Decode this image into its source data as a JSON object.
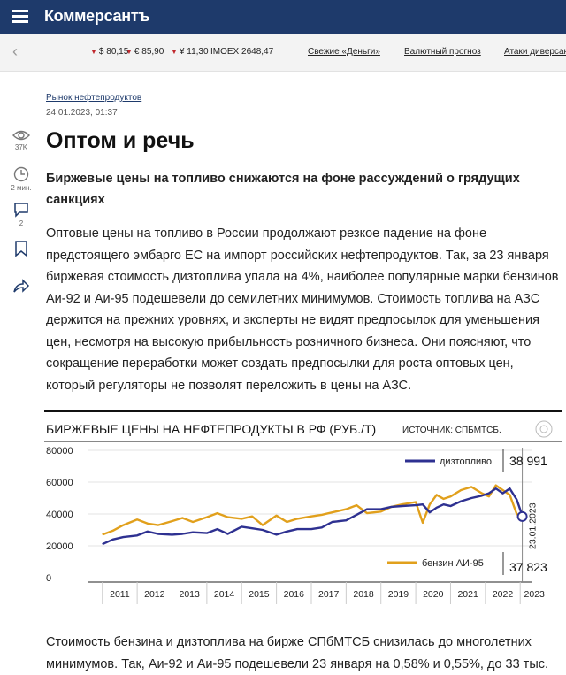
{
  "header": {
    "logo": "Коммерсантъ"
  },
  "ticker": {
    "usd": "$ 80,15",
    "eur": "€ 85,90",
    "cny": "¥ 11,30",
    "imoex": "IMOEX 2648,47",
    "links": [
      "Свежие «Деньги»",
      "Валютный прогноз",
      "Атаки диверсан"
    ]
  },
  "sidebar": {
    "views": "37K",
    "read_time": "2 мин.",
    "comments": "2"
  },
  "article": {
    "rubric": "Рынок нефтепродуктов",
    "date": "24.01.2023, 01:37",
    "title": "Оптом и речь",
    "subtitle": "Биржевые цены на топливо снижаются на фоне рассуждений о грядущих санкциях",
    "paragraph1": "Оптовые цены на топливо в России продолжают резкое падение на фоне предстоящего эмбарго ЕС на импорт российских нефтепродуктов. Так, за 23 января биржевая стоимость дизтоплива упала на 4%, наиболее популярные марки бензинов Аи-92 и Аи-95 подешевели до семилетних минимумов. Стоимость топлива на АЗС держится на прежних уровнях, и эксперты не видят предпосылок для уменьшения цен, несмотря на высокую прибыльность розничного бизнеса. Они поясняют, что сокращение переработки может создать предпосылки для роста оптовых цен, который регуляторы не позволят переложить в цены на АЗС.",
    "paragraph2": "Стоимость бензина и дизтоплива на бирже СПбМТСБ снизилась до многолетних минимумов. Так, Аи-92 и Аи-95 подешевели 23 января на 0,58% и 0,55%, до 33 тыс."
  },
  "chart_data": {
    "type": "line",
    "title": "БИРЖЕВЫЕ ЦЕНЫ НА НЕФТЕПРОДУКТЫ В РФ (РУБ./Т)",
    "source": "ИСТОЧНИК: СПБМТСБ.",
    "yticks": [
      "80000",
      "60000",
      "40000",
      "20000",
      "0"
    ],
    "ylim": [
      0,
      80000
    ],
    "xticks": [
      "2011",
      "2012",
      "2013",
      "2014",
      "2015",
      "2016",
      "2017",
      "2018",
      "2019",
      "2020",
      "2021",
      "2022",
      "2023"
    ],
    "end_date": "23.01.2023",
    "colors": {
      "diesel": "#2e3191",
      "gasoline": "#e1a01c"
    },
    "series": [
      {
        "name": "дизтопливо",
        "end_label": "38 991",
        "x": [
          2011.0,
          2011.3,
          2011.6,
          2012.0,
          2012.3,
          2012.6,
          2013.0,
          2013.3,
          2013.6,
          2014.0,
          2014.3,
          2014.6,
          2015.0,
          2015.3,
          2015.6,
          2016.0,
          2016.3,
          2016.6,
          2017.0,
          2017.3,
          2017.6,
          2018.0,
          2018.3,
          2018.6,
          2019.0,
          2019.3,
          2019.6,
          2020.0,
          2020.2,
          2020.4,
          2020.6,
          2020.8,
          2021.0,
          2021.3,
          2021.6,
          2021.9,
          2022.1,
          2022.3,
          2022.5,
          2022.7,
          2022.9,
          2023.06
        ],
        "y": [
          21000,
          24000,
          25500,
          26500,
          29000,
          27500,
          27000,
          27500,
          28500,
          28000,
          30500,
          27500,
          32000,
          31000,
          30000,
          27000,
          29000,
          30500,
          30500,
          31500,
          35000,
          36000,
          39500,
          43000,
          43000,
          44500,
          45000,
          45500,
          46000,
          41000,
          44000,
          46000,
          45000,
          48000,
          50000,
          51500,
          53000,
          56000,
          53000,
          56000,
          49000,
          38991
        ]
      },
      {
        "name": "бензин АИ-95",
        "end_label": "37 823",
        "x": [
          2011.0,
          2011.3,
          2011.6,
          2012.0,
          2012.3,
          2012.6,
          2013.0,
          2013.3,
          2013.6,
          2014.0,
          2014.3,
          2014.6,
          2015.0,
          2015.3,
          2015.6,
          2016.0,
          2016.3,
          2016.6,
          2017.0,
          2017.3,
          2017.6,
          2018.0,
          2018.3,
          2018.6,
          2019.0,
          2019.3,
          2019.6,
          2020.0,
          2020.2,
          2020.4,
          2020.6,
          2020.8,
          2021.0,
          2021.3,
          2021.6,
          2021.9,
          2022.1,
          2022.3,
          2022.5,
          2022.7,
          2022.9,
          2023.06
        ],
        "y": [
          27000,
          29500,
          33000,
          36500,
          34000,
          33000,
          35500,
          37500,
          35000,
          38000,
          40500,
          38000,
          37000,
          38500,
          33000,
          39000,
          35000,
          37000,
          38500,
          39500,
          41000,
          43000,
          45500,
          40500,
          41500,
          44500,
          46000,
          47500,
          34500,
          46000,
          52000,
          49500,
          51000,
          55000,
          57000,
          53000,
          51000,
          58000,
          55000,
          52000,
          40000,
          37823
        ]
      }
    ]
  }
}
